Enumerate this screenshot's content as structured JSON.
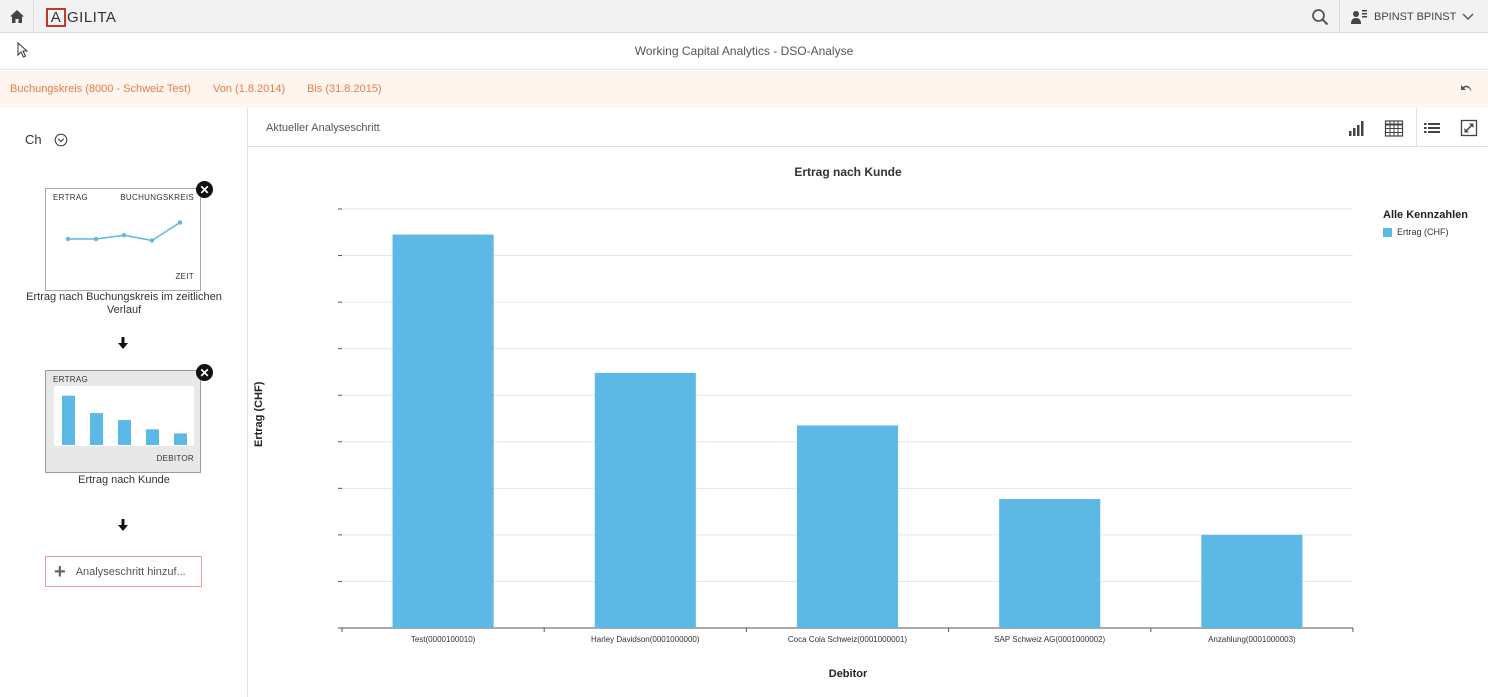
{
  "header": {
    "logo_text": "GILITA",
    "logo_letter": "A",
    "user_name": "BPINST BPINST",
    "icons": [
      "home-icon",
      "search-icon",
      "user-icon",
      "chevron-down-icon"
    ]
  },
  "title_bar": {
    "title": "Working Capital Analytics - DSO-Analyse"
  },
  "filters": {
    "buchungskreis": "Buchungskreis (8000 - Schweiz Test)",
    "von": "Von (1.8.2014)",
    "bis": "Bis (31.8.2015)"
  },
  "left_panel": {
    "selector_label": "Ch",
    "steps": [
      {
        "top_left": "ERTRAG",
        "top_right": "BUCHUNGSKREIS",
        "bottom_right": "ZEIT",
        "caption": "Ertrag nach Buchungskreis im zeitlichen Verlauf",
        "thumb_type": "line",
        "thumb_values": [
          0.4,
          0.4,
          0.45,
          0.38,
          0.62
        ]
      },
      {
        "top_left": "ERTRAG",
        "top_right": "",
        "bottom_right": "DEBITOR",
        "caption": "Ertrag nach Kunde",
        "thumb_type": "bar",
        "thumb_values": [
          0.85,
          0.55,
          0.43,
          0.27,
          0.2
        ]
      }
    ],
    "add_step_label": "Analyseschritt hinzuf..."
  },
  "toolbar": {
    "step_title": "Aktueller Analyseschritt",
    "icons": [
      "bar-chart-icon",
      "table-icon",
      "list-icon",
      "fullscreen-icon"
    ]
  },
  "chart_data": {
    "type": "bar",
    "title": "Ertrag nach Kunde",
    "xlabel": "Debitor",
    "ylabel": "Ertrag (CHF)",
    "legend_title": "Alle Kennzahlen",
    "legend_placement": "top-right",
    "grid": true,
    "y_tick_count": 9,
    "categories": [
      "Test(0000100010)",
      "Harley Davidson(0001000000)",
      "Coca Cola Schweiz(0001000001)",
      "SAP Schweiz AG(0001000002)",
      "Anzahlung(0001000003)"
    ],
    "series": [
      {
        "name": "Ertrag (CHF)",
        "values": [
          0.845,
          0.548,
          0.435,
          0.277,
          0.2
        ]
      }
    ],
    "ylim": [
      0,
      0.9
    ],
    "colors": {
      "bar": "#5cb8e4"
    }
  }
}
